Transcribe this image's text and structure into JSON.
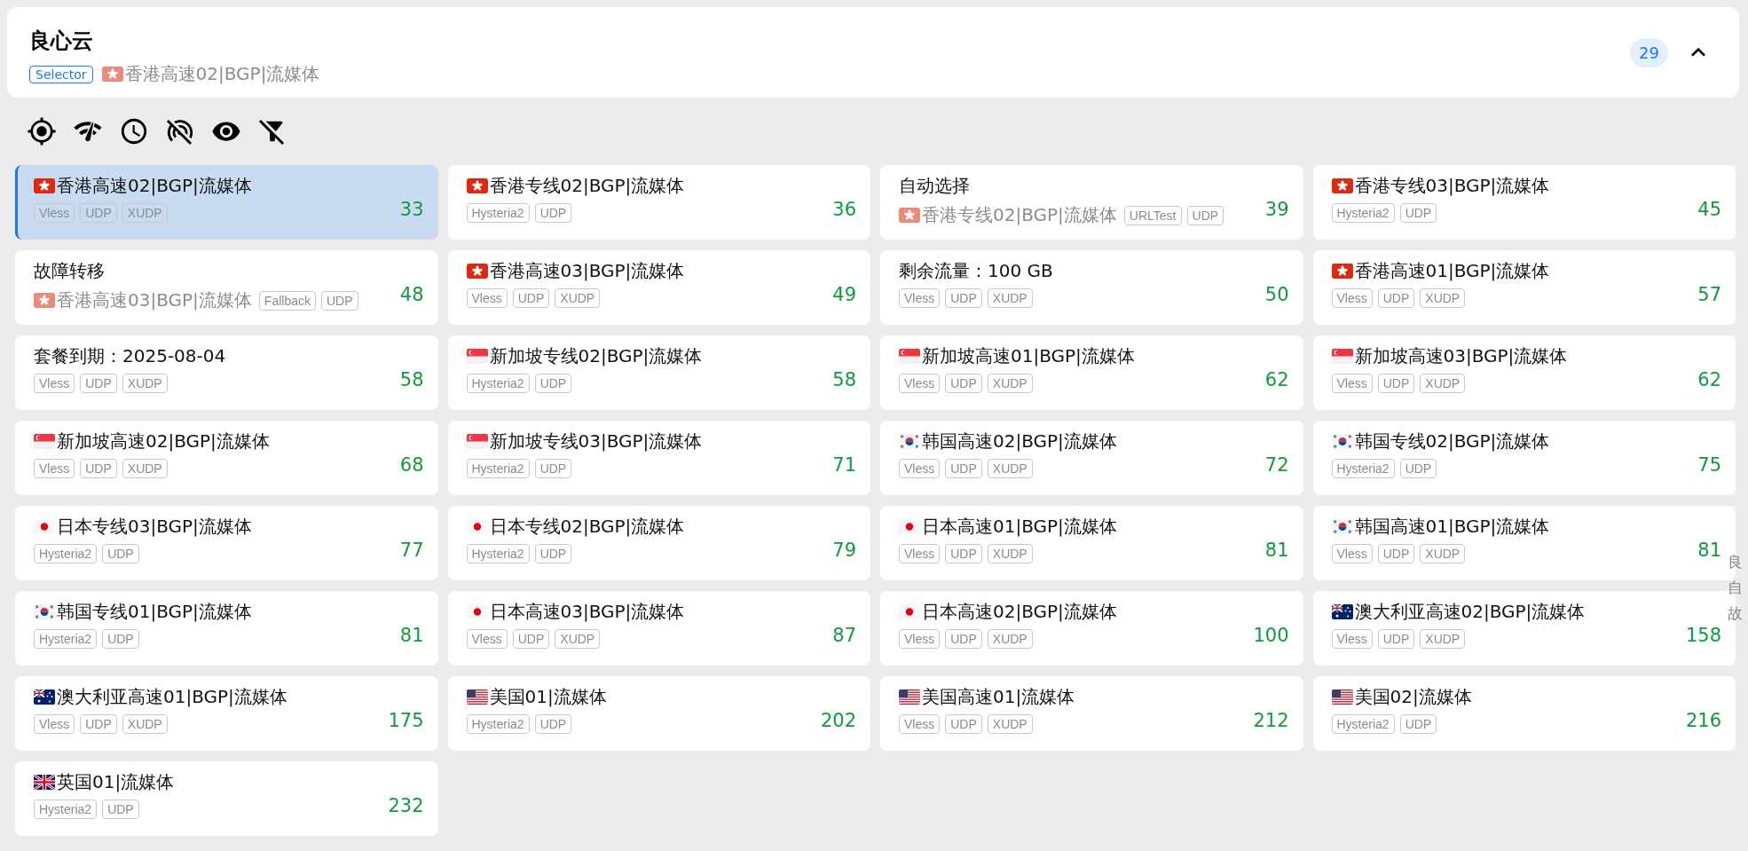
{
  "group": {
    "name": "良心云",
    "type": "Selector",
    "now": {
      "kind": "hk",
      "name": "香港高速02|BGP|流媒体"
    },
    "count": "29",
    "expanded": true
  },
  "proxies": [
    {
      "name": "香港高速02|BGP|流媒体",
      "kind": "hk",
      "tags": [
        "Vless",
        "UDP",
        "XUDP"
      ],
      "delay": "33",
      "selected": true
    },
    {
      "name": "香港专线02|BGP|流媒体",
      "kind": "hk",
      "tags": [
        "Hysteria2",
        "UDP"
      ],
      "delay": "36",
      "selected": false
    },
    {
      "name": "自动选择",
      "kind": "none",
      "now": {
        "kind": "hk",
        "name": "香港专线02|BGP|流媒体"
      },
      "tags": [
        "URLTest",
        "UDP"
      ],
      "delay": "39",
      "selected": false
    },
    {
      "name": "香港专线03|BGP|流媒体",
      "kind": "hk",
      "tags": [
        "Hysteria2",
        "UDP"
      ],
      "delay": "45",
      "selected": false
    },
    {
      "name": "故障转移",
      "kind": "none",
      "now": {
        "kind": "hk",
        "name": "香港高速03|BGP|流媒体"
      },
      "tags": [
        "Fallback",
        "UDP"
      ],
      "delay": "48",
      "selected": false
    },
    {
      "name": "香港高速03|BGP|流媒体",
      "kind": "hk",
      "tags": [
        "Vless",
        "UDP",
        "XUDP"
      ],
      "delay": "49",
      "selected": false
    },
    {
      "name": "剩余流量：100 GB",
      "kind": "none",
      "tags": [
        "Vless",
        "UDP",
        "XUDP"
      ],
      "delay": "50",
      "selected": false
    },
    {
      "name": "香港高速01|BGP|流媒体",
      "kind": "hk",
      "tags": [
        "Vless",
        "UDP",
        "XUDP"
      ],
      "delay": "57",
      "selected": false
    },
    {
      "name": "套餐到期：2025-08-04",
      "kind": "none",
      "tags": [
        "Vless",
        "UDP",
        "XUDP"
      ],
      "delay": "58",
      "selected": false
    },
    {
      "name": "新加坡专线02|BGP|流媒体",
      "kind": "sg",
      "tags": [
        "Hysteria2",
        "UDP"
      ],
      "delay": "58",
      "selected": false
    },
    {
      "name": "新加坡高速01|BGP|流媒体",
      "kind": "sg",
      "tags": [
        "Vless",
        "UDP",
        "XUDP"
      ],
      "delay": "62",
      "selected": false
    },
    {
      "name": "新加坡高速03|BGP|流媒体",
      "kind": "sg",
      "tags": [
        "Vless",
        "UDP",
        "XUDP"
      ],
      "delay": "62",
      "selected": false
    },
    {
      "name": "新加坡高速02|BGP|流媒体",
      "kind": "sg",
      "tags": [
        "Vless",
        "UDP",
        "XUDP"
      ],
      "delay": "68",
      "selected": false
    },
    {
      "name": "新加坡专线03|BGP|流媒体",
      "kind": "sg",
      "tags": [
        "Hysteria2",
        "UDP"
      ],
      "delay": "71",
      "selected": false
    },
    {
      "name": "韩国高速02|BGP|流媒体",
      "kind": "kr",
      "tags": [
        "Vless",
        "UDP",
        "XUDP"
      ],
      "delay": "72",
      "selected": false
    },
    {
      "name": "韩国专线02|BGP|流媒体",
      "kind": "kr",
      "tags": [
        "Hysteria2",
        "UDP"
      ],
      "delay": "75",
      "selected": false
    },
    {
      "name": "日本专线03|BGP|流媒体",
      "kind": "jp",
      "tags": [
        "Hysteria2",
        "UDP"
      ],
      "delay": "77",
      "selected": false
    },
    {
      "name": "日本专线02|BGP|流媒体",
      "kind": "jp",
      "tags": [
        "Hysteria2",
        "UDP"
      ],
      "delay": "79",
      "selected": false
    },
    {
      "name": "日本高速01|BGP|流媒体",
      "kind": "jp",
      "tags": [
        "Vless",
        "UDP",
        "XUDP"
      ],
      "delay": "81",
      "selected": false
    },
    {
      "name": "韩国高速01|BGP|流媒体",
      "kind": "kr",
      "tags": [
        "Vless",
        "UDP",
        "XUDP"
      ],
      "delay": "81",
      "selected": false
    },
    {
      "name": "韩国专线01|BGP|流媒体",
      "kind": "kr",
      "tags": [
        "Hysteria2",
        "UDP"
      ],
      "delay": "81",
      "selected": false
    },
    {
      "name": "日本高速03|BGP|流媒体",
      "kind": "jp",
      "tags": [
        "Vless",
        "UDP",
        "XUDP"
      ],
      "delay": "87",
      "selected": false
    },
    {
      "name": "日本高速02|BGP|流媒体",
      "kind": "jp",
      "tags": [
        "Vless",
        "UDP",
        "XUDP"
      ],
      "delay": "100",
      "selected": false
    },
    {
      "name": "澳大利亚高速02|BGP|流媒体",
      "kind": "au",
      "tags": [
        "Vless",
        "UDP",
        "XUDP"
      ],
      "delay": "158",
      "selected": false
    },
    {
      "name": "澳大利亚高速01|BGP|流媒体",
      "kind": "au",
      "tags": [
        "Vless",
        "UDP",
        "XUDP"
      ],
      "delay": "175",
      "selected": false
    },
    {
      "name": "美国01|流媒体",
      "kind": "us",
      "tags": [
        "Hysteria2",
        "UDP"
      ],
      "delay": "202",
      "selected": false
    },
    {
      "name": "美国高速01|流媒体",
      "kind": "us",
      "tags": [
        "Vless",
        "UDP",
        "XUDP"
      ],
      "delay": "212",
      "selected": false
    },
    {
      "name": "美国02|流媒体",
      "kind": "us",
      "tags": [
        "Hysteria2",
        "UDP"
      ],
      "delay": "216",
      "selected": false
    },
    {
      "name": "英国01|流媒体",
      "kind": "gb",
      "tags": [
        "Hysteria2",
        "UDP"
      ],
      "delay": "232",
      "selected": false
    }
  ],
  "index": [
    "良",
    "自",
    "故"
  ]
}
